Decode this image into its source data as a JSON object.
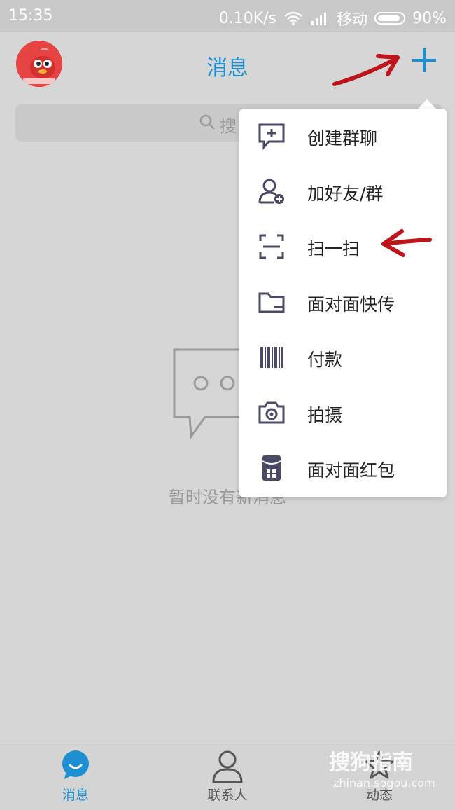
{
  "status_bar": {
    "time": "15:35",
    "network_speed": "0.10K/s",
    "carrier": "移动",
    "battery": "90%"
  },
  "header": {
    "title": "消息"
  },
  "search": {
    "placeholder": "搜"
  },
  "empty_state": {
    "text": "暂时没有新消息"
  },
  "menu": {
    "items": [
      {
        "label": "创建群聊",
        "icon": "create-group-chat-icon"
      },
      {
        "label": "加好友/群",
        "icon": "add-friend-icon"
      },
      {
        "label": "扫一扫",
        "icon": "scan-icon"
      },
      {
        "label": "面对面快传",
        "icon": "folder-transfer-icon"
      },
      {
        "label": "付款",
        "icon": "barcode-payment-icon"
      },
      {
        "label": "拍摄",
        "icon": "camera-icon"
      },
      {
        "label": "面对面红包",
        "icon": "red-packet-icon"
      }
    ]
  },
  "tabs": [
    {
      "label": "消息",
      "active": true
    },
    {
      "label": "联系人",
      "active": false
    },
    {
      "label": "动态",
      "active": false
    }
  ],
  "watermark": {
    "brand": "搜狗指南",
    "url": "zhinan.sogou.com"
  },
  "colors": {
    "accent": "#1e8fd0",
    "annotation_arrow": "#c0141c"
  }
}
